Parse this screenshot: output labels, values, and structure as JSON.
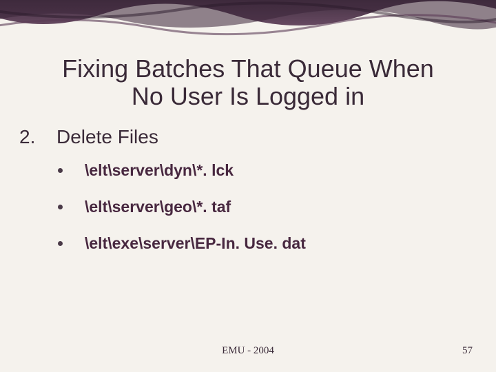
{
  "title_line1": "Fixing Batches That Queue When",
  "title_line2": "No User Is Logged in",
  "section": {
    "number": "2.",
    "label": "Delete Files"
  },
  "bullets": [
    "\\elt\\server\\dyn\\*. lck",
    "\\elt\\server\\geo\\*. taf",
    "\\elt\\exe\\server\\EP-In. Use. dat"
  ],
  "footer": {
    "center": "EMU - 2004",
    "page": "57"
  },
  "colors": {
    "heading": "#3a2a38",
    "bullet_text": "#482840",
    "background": "#f5f2ed"
  }
}
